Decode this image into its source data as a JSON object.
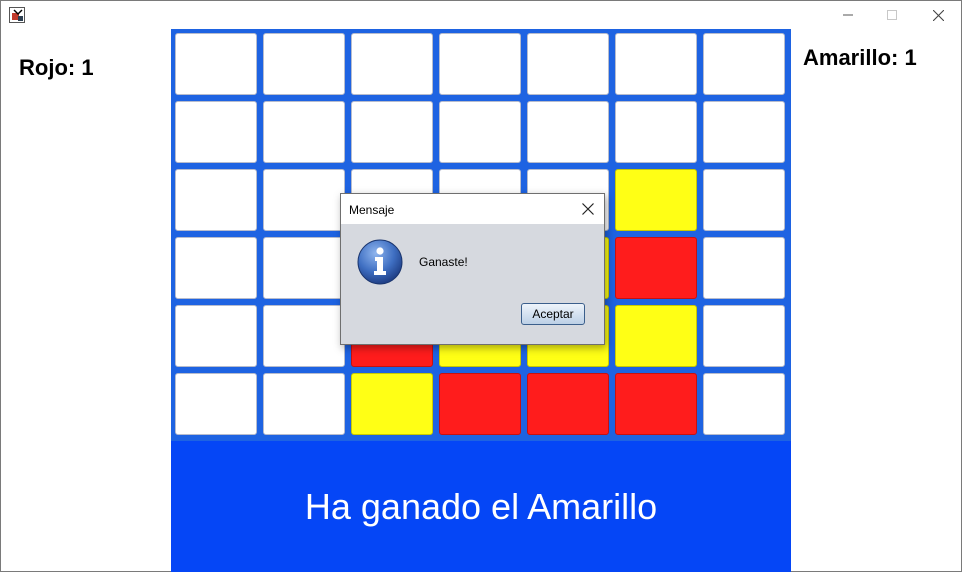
{
  "window": {
    "minimize_icon": "minimize-icon",
    "maximize_icon": "maximize-icon",
    "close_icon": "close-icon"
  },
  "scores": {
    "red": "Rojo: 1",
    "yellow": "Amarillo: 1"
  },
  "board": {
    "columns": 7,
    "rows": 6,
    "colors": {
      "frame": "#1e63e2",
      "empty": "#ffffff",
      "red": "#ff1c1c",
      "yellow": "#ffff15"
    },
    "cells": [
      [
        "E",
        "E",
        "E",
        "E",
        "E",
        "E",
        "E"
      ],
      [
        "E",
        "E",
        "E",
        "E",
        "E",
        "E",
        "E"
      ],
      [
        "E",
        "E",
        "E",
        "E",
        "E",
        "Y",
        "E"
      ],
      [
        "E",
        "E",
        "E",
        "Y",
        "Y",
        "R",
        "E"
      ],
      [
        "E",
        "E",
        "R",
        "Y",
        "Y",
        "Y",
        "E"
      ],
      [
        "E",
        "E",
        "Y",
        "R",
        "R",
        "R",
        "E"
      ]
    ]
  },
  "status": {
    "message": "Ha ganado el Amarillo",
    "background": "#0546f6"
  },
  "dialog": {
    "title": "Mensaje",
    "message": "Ganaste!",
    "button_label": "Aceptar",
    "icon": "information-icon"
  }
}
